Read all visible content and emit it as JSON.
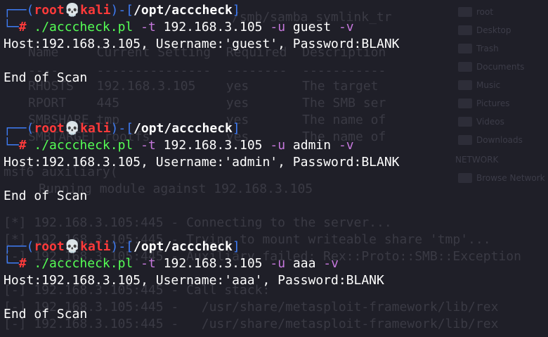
{
  "prompt": {
    "user": "root",
    "skull": "💀",
    "host": "kali",
    "path": "/opt/acccheck",
    "hash": "#",
    "box_top": "┌──(",
    "box_sep": ")-[",
    "box_close": "]",
    "box_bottom": "└─"
  },
  "runs": [
    {
      "cmd": "./acccheck.pl",
      "flag_t": "-t",
      "ip": "192.168.3.105",
      "flag_u": "-u",
      "user": "guest",
      "flag_v": "-v",
      "result": "Host:192.168.3.105, Username:'guest', Password:BLANK",
      "end": "End of Scan"
    },
    {
      "cmd": "./acccheck.pl",
      "flag_t": "-t",
      "ip": "192.168.3.105",
      "flag_u": "-u",
      "user": "admin",
      "flag_v": "-v",
      "result": "Host:192.168.3.105, Username:'admin', Password:BLANK",
      "end": "End of Scan"
    },
    {
      "cmd": "./acccheck.pl",
      "flag_t": "-t",
      "ip": "192.168.3.105",
      "flag_u": "-u",
      "user": "aaa",
      "flag_v": "-v",
      "result": "Host:192.168.3.105, Username:'aaa', Password:BLANK",
      "end": "End of Scan"
    }
  ],
  "colors": {
    "background": "#1f1f28",
    "prompt_box": "#3f7cf4",
    "prompt_user": "#ff3a3a",
    "command": "#55ff55",
    "flags": "#c678dd",
    "text": "#ffffff"
  }
}
